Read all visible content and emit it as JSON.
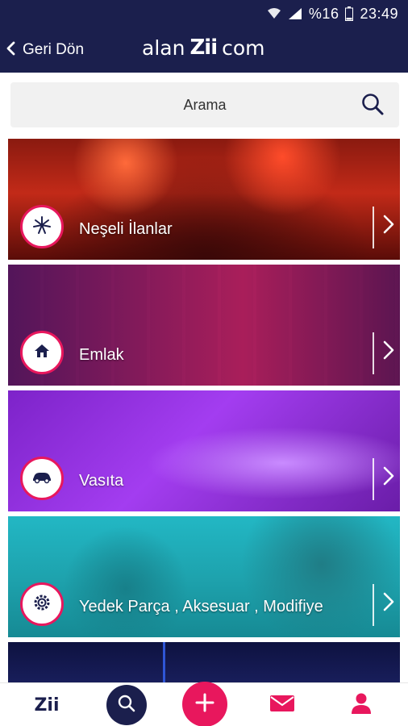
{
  "status_bar": {
    "battery": "%16",
    "time": "23:49"
  },
  "header": {
    "back_label": "Geri Dön",
    "brand": {
      "part1": "alan",
      "part2": "Zii",
      "part3": "com"
    }
  },
  "search": {
    "placeholder": "Arama"
  },
  "categories": [
    {
      "label": "Neşeli İlanlar",
      "icon": "fireworks-icon"
    },
    {
      "label": "Emlak",
      "icon": "home-icon"
    },
    {
      "label": "Vasıta",
      "icon": "car-icon"
    },
    {
      "label": "Yedek Parça , Aksesuar , Modifiye",
      "icon": "gear-icon"
    }
  ],
  "bottom_nav": {
    "logo": "Zii",
    "items": [
      "home-logo",
      "search-icon",
      "add-icon",
      "mail-icon",
      "user-icon"
    ]
  },
  "colors": {
    "navy": "#1b1f4d",
    "accent": "#e8175d"
  }
}
